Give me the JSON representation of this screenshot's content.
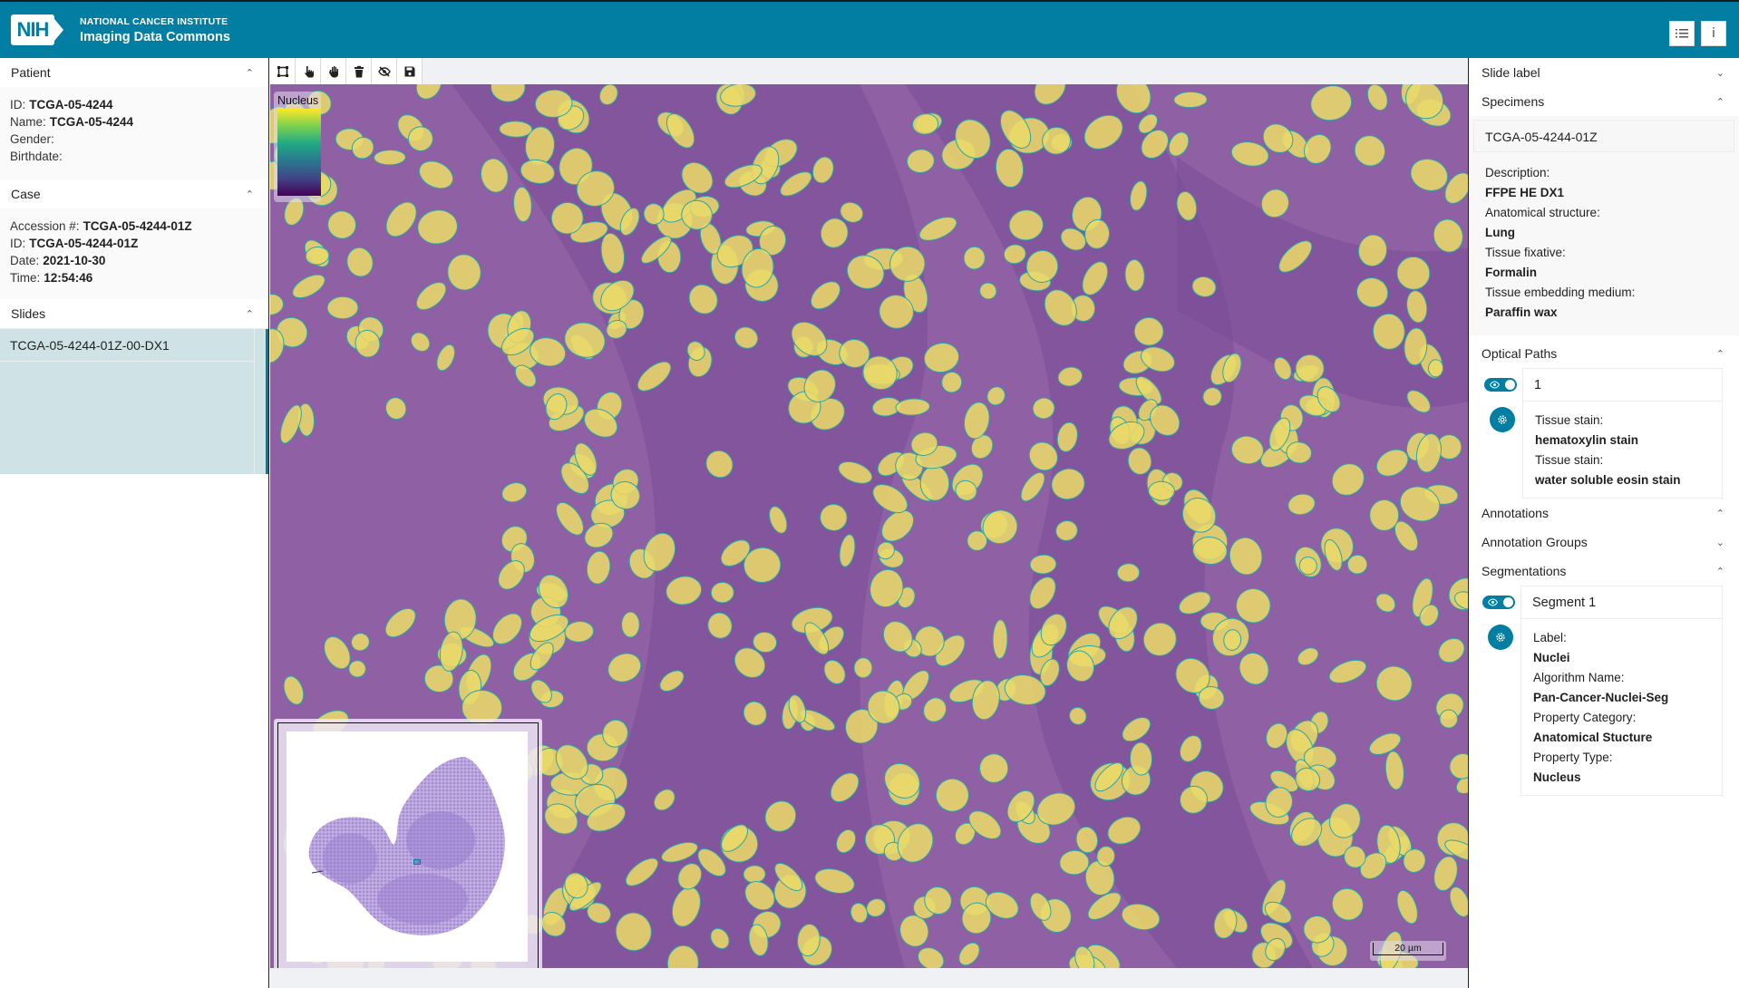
{
  "header": {
    "org": "NATIONAL CANCER INSTITUTE",
    "app": "Imaging Data Commons",
    "logo_text": "NIH",
    "buttons": [
      {
        "name": "worklist-button",
        "icon": "list-icon",
        "glyph": "☰"
      },
      {
        "name": "info-button",
        "icon": "info-icon",
        "glyph": "i"
      }
    ]
  },
  "left": {
    "patient": {
      "title": "Patient",
      "fields": [
        {
          "k": "ID",
          "v": "TCGA-05-4244"
        },
        {
          "k": "Name",
          "v": "TCGA-05-4244"
        },
        {
          "k": "Gender",
          "v": ""
        },
        {
          "k": "Birthdate",
          "v": ""
        }
      ]
    },
    "case": {
      "title": "Case",
      "fields": [
        {
          "k": "Accession #",
          "v": "TCGA-05-4244-01Z"
        },
        {
          "k": "ID",
          "v": "TCGA-05-4244-01Z"
        },
        {
          "k": "Date",
          "v": "2021-10-30"
        },
        {
          "k": "Time",
          "v": "12:54:46"
        }
      ]
    },
    "slides": {
      "title": "Slides",
      "items": [
        "TCGA-05-4244-01Z-00-DX1"
      ]
    }
  },
  "toolbar": {
    "tools": [
      {
        "name": "draw-tool",
        "icon": "draw-roi-icon"
      },
      {
        "name": "select-tool",
        "icon": "pointer-hand-icon"
      },
      {
        "name": "pan-tool",
        "icon": "hand-icon"
      },
      {
        "name": "delete-tool",
        "icon": "trash-icon"
      },
      {
        "name": "hide-tool",
        "icon": "eye-slash-icon"
      },
      {
        "name": "save-tool",
        "icon": "save-icon"
      }
    ]
  },
  "viewer": {
    "legend_title": "Nucleus",
    "legend_colors": [
      "#fde725",
      "#7ad151",
      "#22a884",
      "#2a788e",
      "#414487",
      "#440154"
    ],
    "scale_label": "20 µm",
    "colors": {
      "tissue": "#8f60a3",
      "nucleus": "#e9d869",
      "outline": "#2aa6a8"
    }
  },
  "right": {
    "slide_label": {
      "title": "Slide label"
    },
    "specimens": {
      "title": "Specimens",
      "id": "TCGA-05-4244-01Z",
      "fields": [
        {
          "k": "Description",
          "v": "FFPE HE DX1"
        },
        {
          "k": "Anatomical structure",
          "v": "Lung"
        },
        {
          "k": "Tissue fixative",
          "v": "Formalin"
        },
        {
          "k": "Tissue embedding medium",
          "v": "Paraffin wax"
        }
      ]
    },
    "optical_paths": {
      "title": "Optical Paths",
      "items": [
        {
          "id": "1",
          "visible": true,
          "fields": [
            {
              "k": "Tissue stain",
              "v": "hematoxylin stain"
            },
            {
              "k": "Tissue stain",
              "v": "water soluble eosin stain"
            }
          ]
        }
      ]
    },
    "annotations": {
      "title": "Annotations"
    },
    "annotation_groups": {
      "title": "Annotation Groups"
    },
    "segmentations": {
      "title": "Segmentations",
      "items": [
        {
          "id": "Segment 1",
          "visible": true,
          "fields": [
            {
              "k": "Label",
              "v": "Nuclei"
            },
            {
              "k": "Algorithm Name",
              "v": "Pan-Cancer-Nuclei-Seg"
            },
            {
              "k": "Property Category",
              "v": "Anatomical Stucture"
            },
            {
              "k": "Property Type",
              "v": "Nucleus"
            }
          ]
        }
      ]
    }
  },
  "brand_color": "#027ea3"
}
